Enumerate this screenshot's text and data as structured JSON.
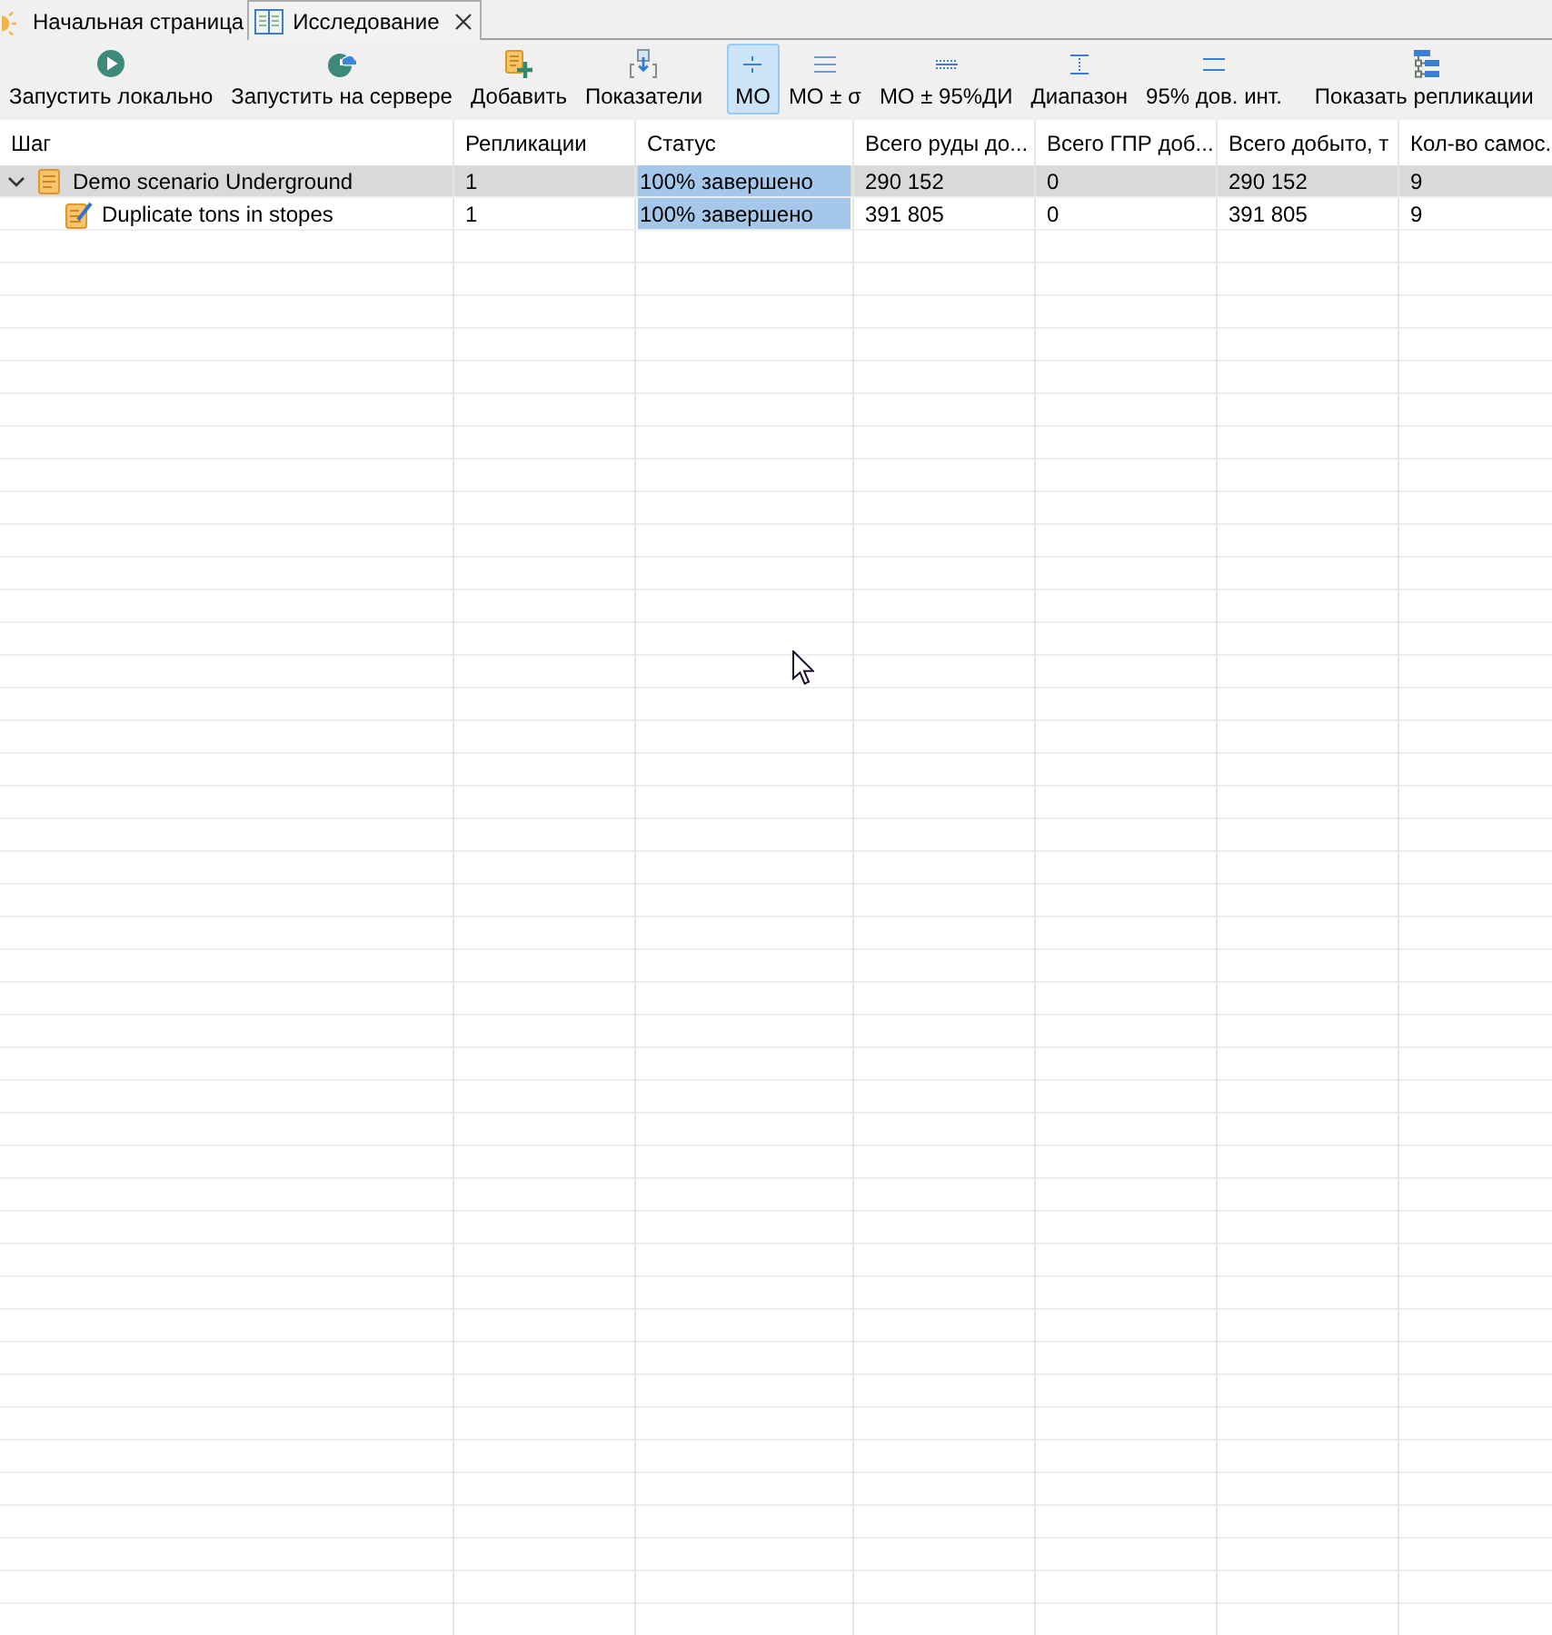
{
  "tabs": [
    {
      "label": "Начальная страница",
      "kind": "home",
      "selected": false,
      "closable": false
    },
    {
      "label": "Исследование",
      "kind": "study",
      "selected": true,
      "closable": true
    }
  ],
  "toolbar": {
    "actions": [
      {
        "label": "Запустить локально",
        "kind": "run-local"
      },
      {
        "label": "Запустить на сервере",
        "kind": "run-server"
      },
      {
        "label": "Добавить",
        "kind": "add"
      },
      {
        "label": "Показатели",
        "kind": "indicators"
      }
    ],
    "statistic_modes": [
      {
        "label": "МО",
        "kind": "mean",
        "selected": true
      },
      {
        "label": "МО ± σ",
        "kind": "mean-sd",
        "selected": false
      },
      {
        "label": "МО ± 95%ДИ",
        "kind": "mean-ci",
        "selected": false
      },
      {
        "label": "Диапазон",
        "kind": "range",
        "selected": false
      },
      {
        "label": "95% дов. инт.",
        "kind": "ci",
        "selected": false
      }
    ],
    "show_replications": {
      "label": "Показать репликации",
      "kind": "replications"
    }
  },
  "table": {
    "columns": [
      "Шаг",
      "Репликации",
      "Статус",
      "Всего руды до...",
      "Всего ГПР доб...",
      "Всего добыто, т",
      "Кол-во самос."
    ],
    "rows": [
      {
        "step": "Demo scenario Underground",
        "kind": "scenario",
        "expanded": true,
        "selected": true,
        "replications": "1",
        "status": {
          "text": "100% завершено",
          "level": 1
        },
        "values": [
          "290 152",
          "0",
          "290 152",
          "9"
        ],
        "children": [
          {
            "step": "Duplicate tons in stopes",
            "kind": "edited-scenario",
            "selected": false,
            "replications": "1",
            "status": {
              "text": "100% завершено",
              "level": 1
            },
            "values": [
              "391 805",
              "0",
              "391 805",
              "9"
            ]
          }
        ]
      }
    ]
  }
}
